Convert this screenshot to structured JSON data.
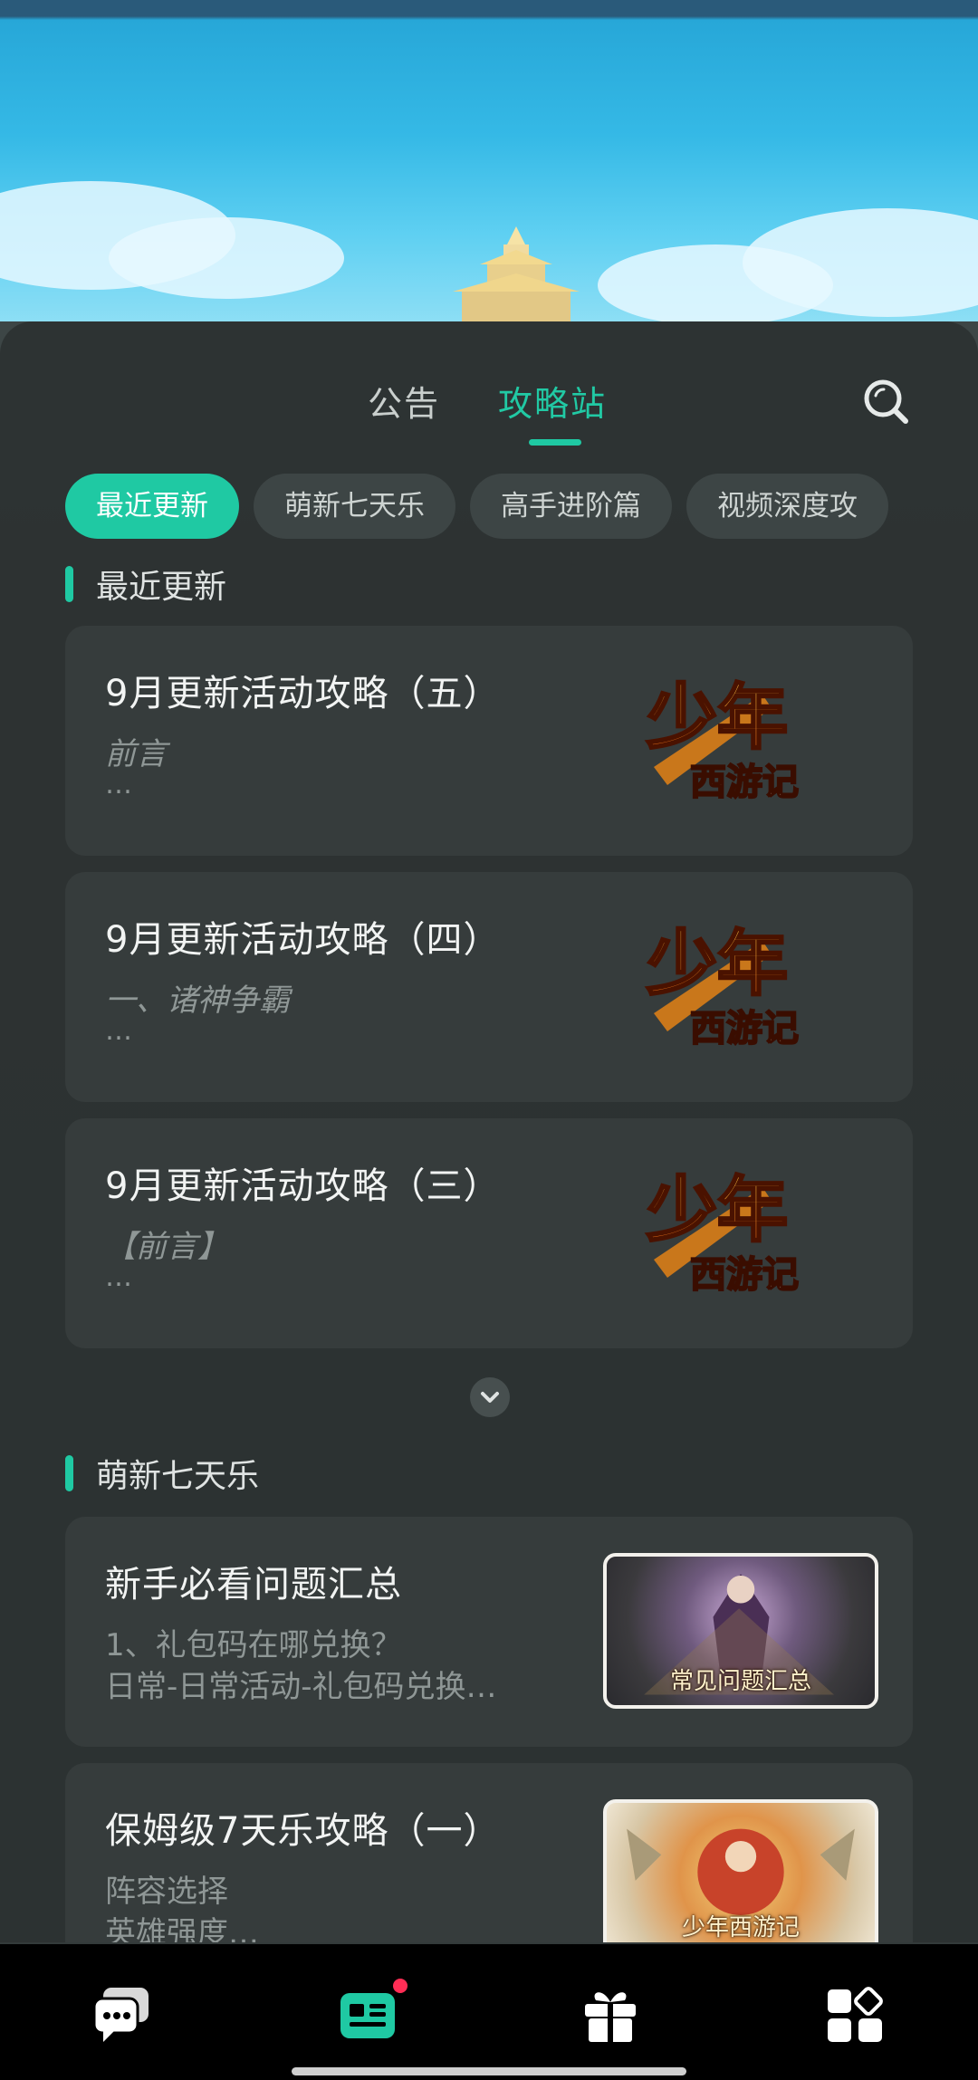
{
  "header": {
    "tabs": [
      {
        "label": "公告",
        "active": false
      },
      {
        "label": "攻略站",
        "active": true
      }
    ]
  },
  "chips": [
    {
      "label": "最近更新",
      "active": true
    },
    {
      "label": "萌新七天乐",
      "active": false
    },
    {
      "label": "高手进阶篇",
      "active": false
    },
    {
      "label": "视频深度攻",
      "active": false
    }
  ],
  "sections": [
    {
      "title": "最近更新",
      "cards": [
        {
          "title": "9月更新活动攻略（五）",
          "line1": "前言",
          "line2": "…",
          "logo_text_top": "少年",
          "logo_text_bottom": "西游记"
        },
        {
          "title": "9月更新活动攻略（四）",
          "line1": "一、诸神争霸",
          "line2": "…",
          "logo_text_top": "少年",
          "logo_text_bottom": "西游记"
        },
        {
          "title": "9月更新活动攻略（三）",
          "line1": "【前言】",
          "line2": "…",
          "logo_text_top": "少年",
          "logo_text_bottom": "西游记"
        }
      ]
    },
    {
      "title": "萌新七天乐",
      "cards": [
        {
          "title": "新手必看问题汇总",
          "line1": "1、礼包码在哪兑换？",
          "line2": "日常-日常活动-礼包码兑换…",
          "thumb_caption": "常见问题汇总"
        },
        {
          "title": "保姆级7天乐攻略（一）",
          "line1": "阵容选择",
          "line2": "英雄强度…",
          "thumb_caption": "少年西游记"
        }
      ]
    }
  ],
  "bottom_nav": [
    {
      "icon": "chat-bubbles-icon",
      "active": false
    },
    {
      "icon": "news-icon",
      "active": true,
      "badge": true
    },
    {
      "icon": "gift-icon",
      "active": false
    },
    {
      "icon": "apps-grid-icon",
      "active": false
    }
  ],
  "colors": {
    "accent": "#1fc9a3",
    "panel": "#2c3232",
    "card": "#363c3c",
    "badge": "#ff2d55"
  }
}
